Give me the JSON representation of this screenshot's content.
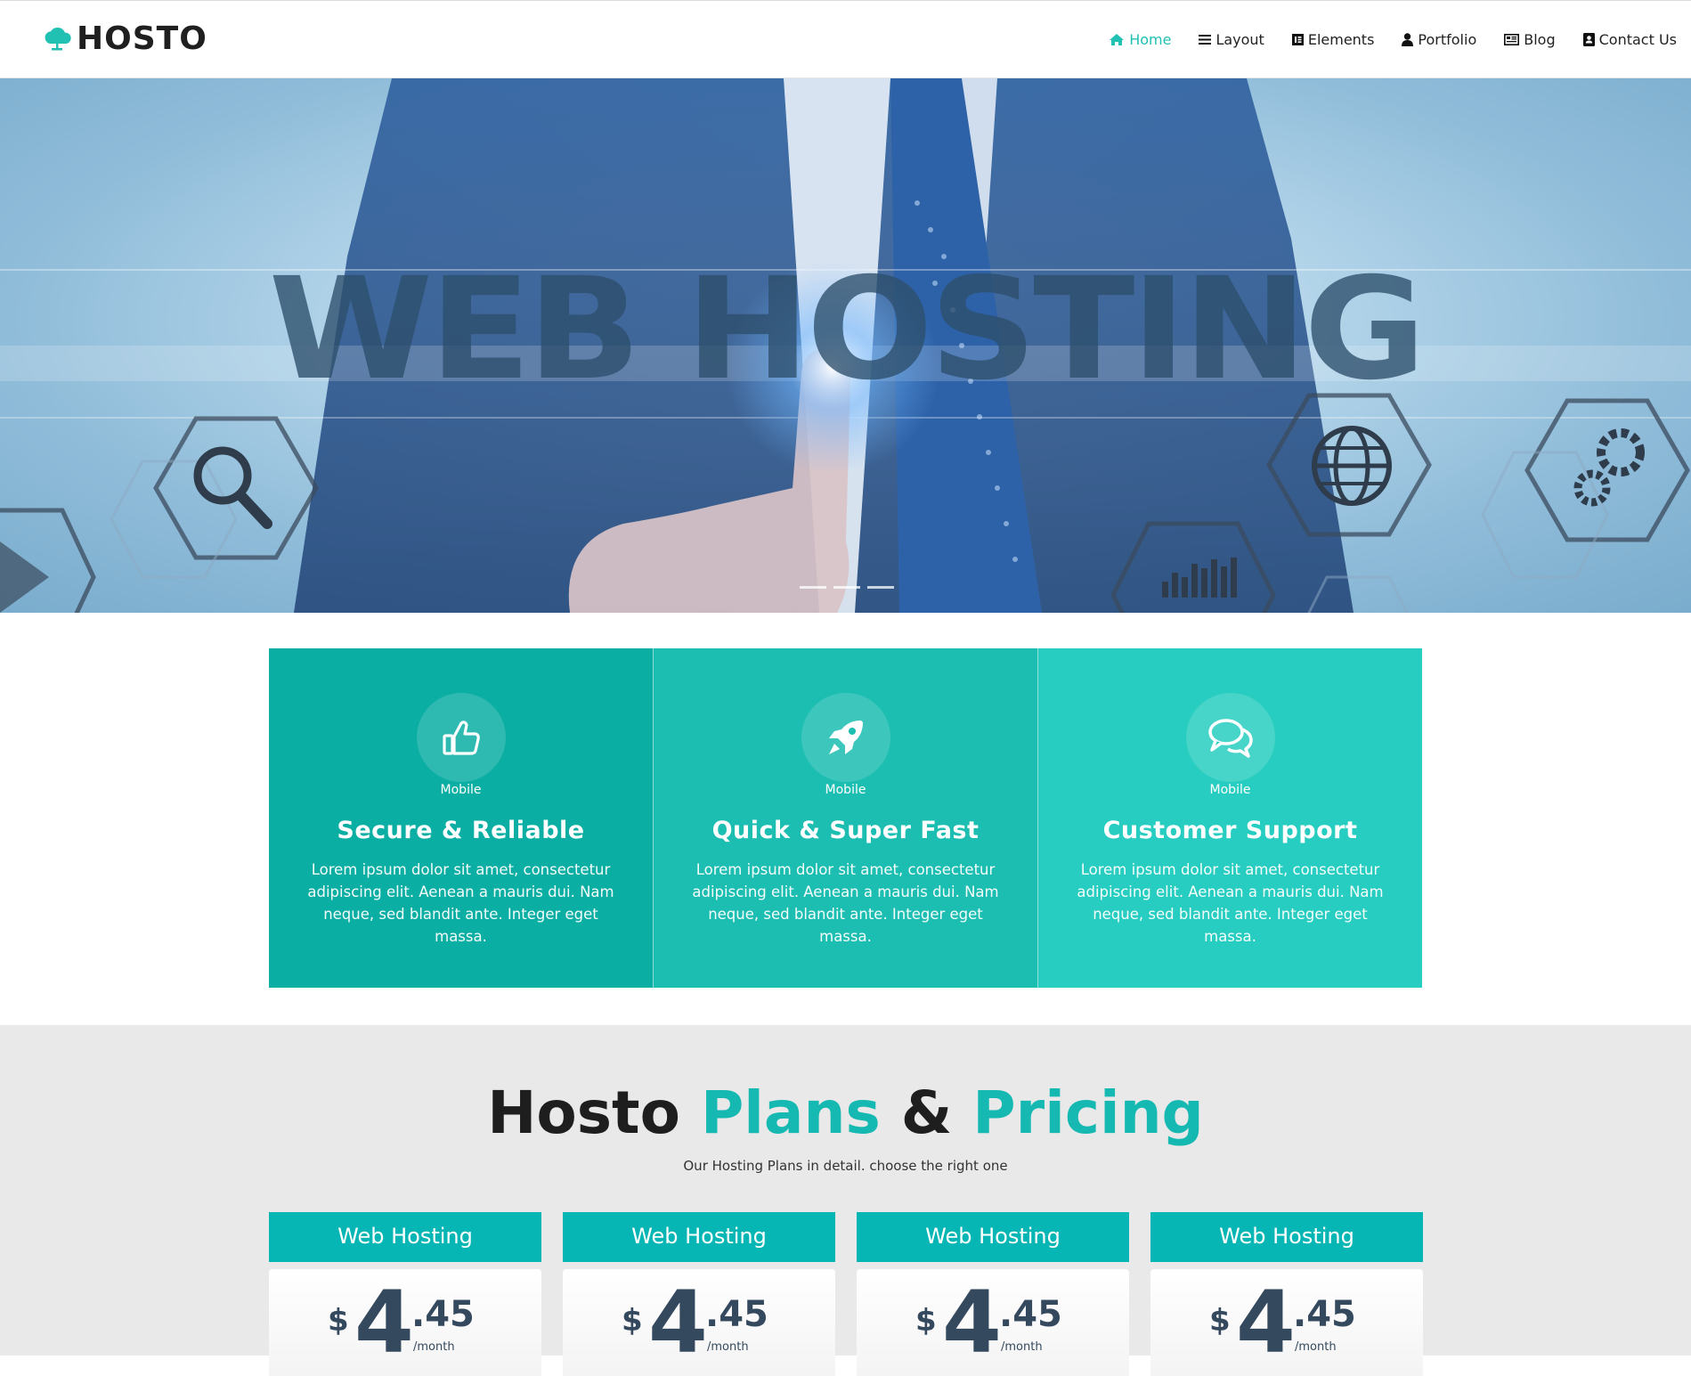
{
  "brand": {
    "name": "HOSTO",
    "icon": "cloud-icon",
    "accent": "#20c0b3"
  },
  "nav": [
    {
      "label": "Home",
      "icon": "home-icon",
      "active": true
    },
    {
      "label": "Layout",
      "icon": "bars-icon",
      "active": false
    },
    {
      "label": "Elements",
      "icon": "elementor-icon",
      "active": false
    },
    {
      "label": "Portfolio",
      "icon": "user-icon",
      "active": false
    },
    {
      "label": "Blog",
      "icon": "newspaper-icon",
      "active": false
    },
    {
      "label": "Contact Us",
      "icon": "address-book-icon",
      "active": false
    }
  ],
  "hero": {
    "headline": "WEB HOSTING",
    "slides": 3
  },
  "features": [
    {
      "icon": "thumbs-up-icon",
      "caption": "Mobile",
      "title": "Secure & Reliable",
      "text": "Lorem ipsum dolor sit amet, consectetur adipiscing elit. Aenean a mauris dui. Nam neque, sed blandit ante. Integer eget massa.",
      "color": "#0aaea3"
    },
    {
      "icon": "rocket-icon",
      "caption": "Mobile",
      "title": "Quick & Super Fast",
      "text": "Lorem ipsum dolor sit amet, consectetur adipiscing elit. Aenean a mauris dui. Nam neque, sed blandit ante. Integer eget massa.",
      "color": "#1cbeb1"
    },
    {
      "icon": "comments-icon",
      "caption": "Mobile",
      "title": "Customer Support",
      "text": "Lorem ipsum dolor sit amet, consectetur adipiscing elit. Aenean a mauris dui. Nam neque, sed blandit ante. Integer eget massa.",
      "color": "#27cdc0"
    }
  ],
  "pricing": {
    "title_part1": "Hosto",
    "title_part2": "Plans",
    "title_amp": "&",
    "title_part3": "Pricing",
    "subtitle": "Our Hosting Plans in detail. choose the right one",
    "plans": [
      {
        "name": "Web Hosting",
        "currency": "$",
        "whole": "4",
        "cents": ".45",
        "period": "/month"
      },
      {
        "name": "Web Hosting",
        "currency": "$",
        "whole": "4",
        "cents": ".45",
        "period": "/month"
      },
      {
        "name": "Web Hosting",
        "currency": "$",
        "whole": "4",
        "cents": ".45",
        "period": "/month"
      },
      {
        "name": "Web Hosting",
        "currency": "$",
        "whole": "4",
        "cents": ".45",
        "period": "/month"
      }
    ]
  }
}
